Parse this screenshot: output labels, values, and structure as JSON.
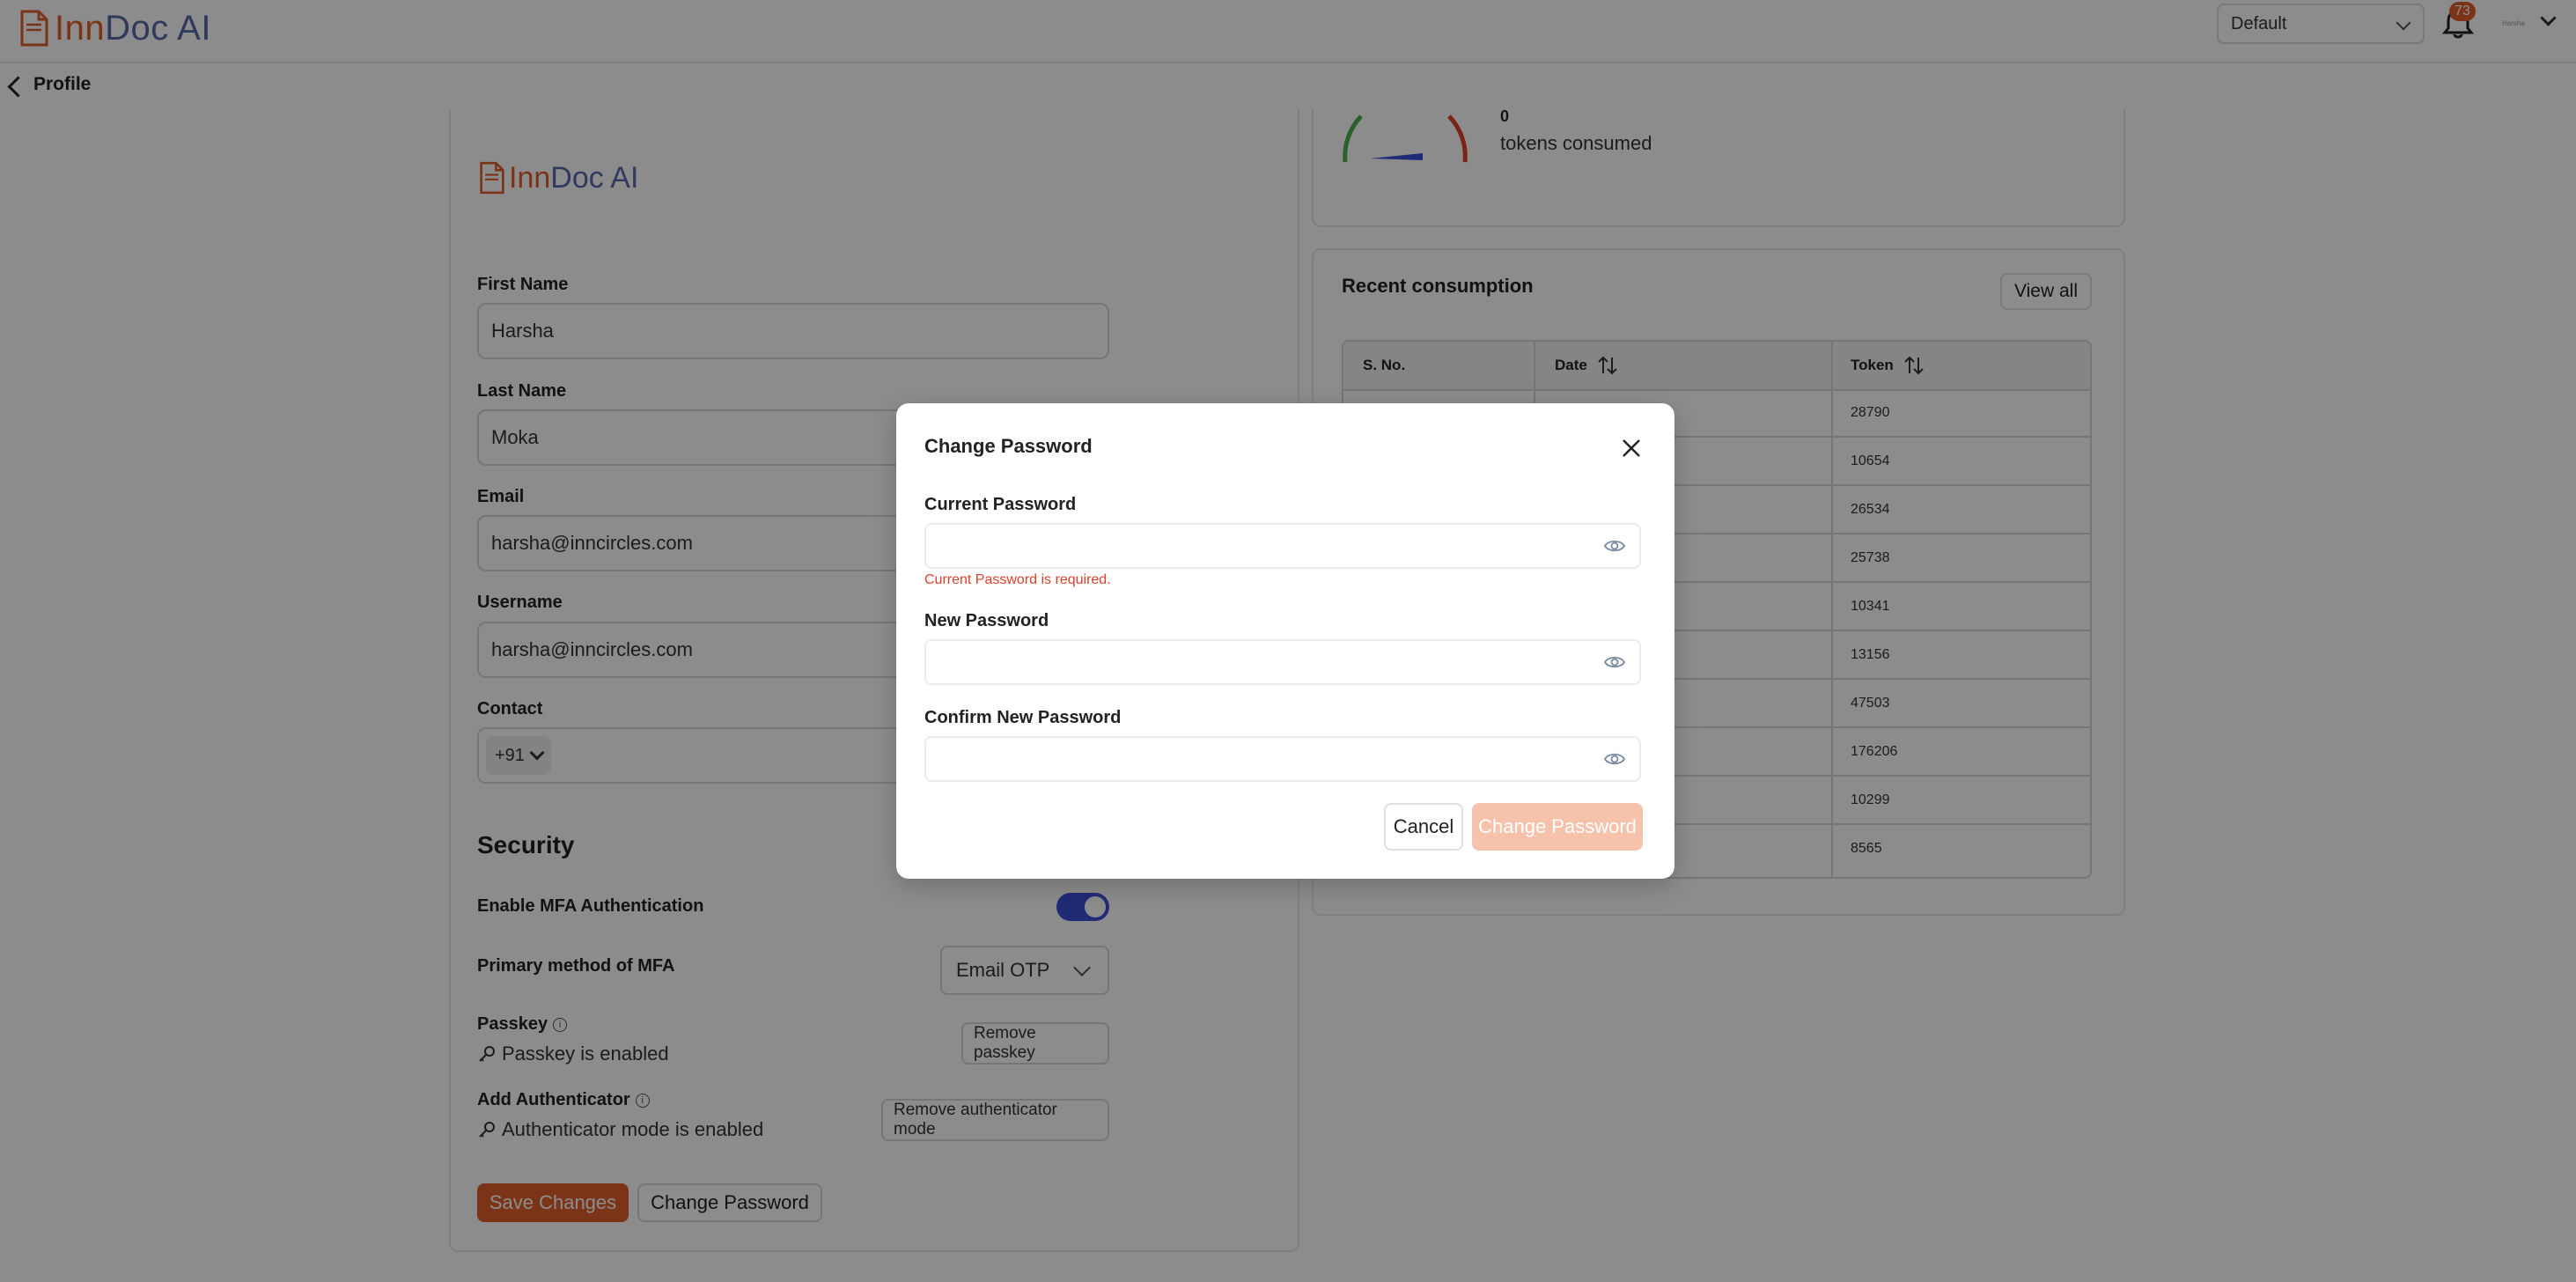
{
  "header": {
    "brand_inn": "Inn",
    "brand_rest": "Doc AI",
    "workspace_selected": "Default",
    "notification_count": "73",
    "avatar_text": "Harsha"
  },
  "subheader": {
    "title": "Profile"
  },
  "profile": {
    "logo_inn": "Inn",
    "logo_rest": "Doc AI",
    "first_name_label": "First Name",
    "first_name_value": "Harsha",
    "last_name_label": "Last Name",
    "last_name_value": "Moka",
    "email_label": "Email",
    "email_value": "harsha@inncircles.com",
    "username_label": "Username",
    "username_value": "harsha@inncircles.com",
    "contact_label": "Contact",
    "contact_code": "+91"
  },
  "security": {
    "title": "Security",
    "mfa_label": "Enable MFA Authentication",
    "mfa_enabled": true,
    "primary_method_label": "Primary method of MFA",
    "primary_method_value": "Email OTP",
    "passkey_label": "Passkey",
    "passkey_status": "Passkey is enabled",
    "remove_passkey_label": "Remove passkey",
    "authenticator_label": "Add Authenticator",
    "authenticator_status": "Authenticator mode is enabled",
    "remove_authenticator_label": "Remove authenticator mode",
    "save_label": "Save Changes",
    "change_password_label": "Change Password"
  },
  "usage": {
    "tokens_value": "0",
    "tokens_caption": "tokens consumed"
  },
  "recent": {
    "title": "Recent consumption",
    "view_all_label": "View all",
    "columns": [
      "S. No.",
      "Date",
      "Token"
    ],
    "tokens": [
      "28790",
      "10654",
      "26534",
      "25738",
      "10341",
      "13156",
      "47503",
      "176206",
      "10299",
      "8565"
    ]
  },
  "modal": {
    "title": "Change Password",
    "current_label": "Current Password",
    "current_value": "",
    "current_error": "Current Password is required.",
    "new_label": "New Password",
    "new_value": "",
    "confirm_label": "Confirm New Password",
    "confirm_value": "",
    "cancel_label": "Cancel",
    "submit_label": "Change Password"
  },
  "colors": {
    "accent": "#e0602a",
    "brand_blue": "#5a6aa8",
    "toggle_on": "#3b4fd8",
    "error": "#e0402a",
    "submit_disabled": "#f7c2ac"
  },
  "icons": [
    "document-logo-icon",
    "bell-icon",
    "chevron-down-icon",
    "back-chevron-icon",
    "key-icon",
    "info-icon",
    "sort-icon",
    "close-icon",
    "eye-icon"
  ]
}
